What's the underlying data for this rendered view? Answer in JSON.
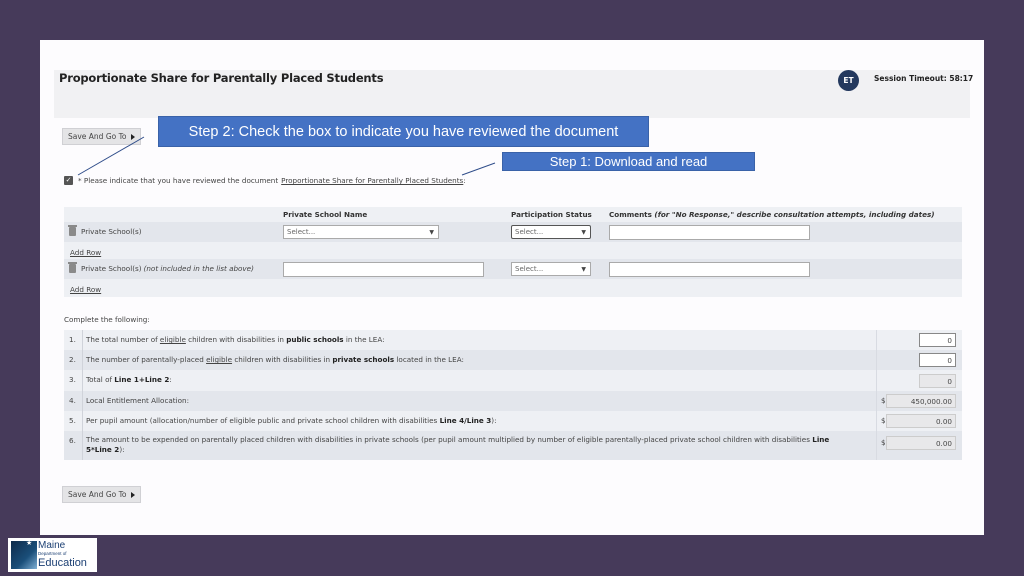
{
  "colors": {
    "slide_background": "#463a5a",
    "callout_blue": "#4472c4",
    "avatar_navy": "#24395e"
  },
  "header": {
    "title": "Proportionate Share for Parentally Placed Students",
    "avatar_initials": "ET",
    "session_timeout": "Session Timeout: 58:17"
  },
  "toolbar": {
    "save_label": "Save And Go To"
  },
  "callouts": {
    "step2": "Step 2: Check the box to indicate you have reviewed the document",
    "step1": "Step 1: Download and read"
  },
  "review": {
    "checked": true,
    "label": "* Please indicate that you have reviewed the document",
    "doc_link": "Proportionate Share for Parentally Placed Students",
    "suffix": ":"
  },
  "schools_table": {
    "headers": {
      "name": "Private School Name",
      "status": "Participation Status",
      "comments_bold": "Comments",
      "comments_italic": "(for \"No Response,\" describe consultation attempts, including dates)"
    },
    "rows": [
      {
        "label": "Private School(s)",
        "label_note": "",
        "name_select": "Select...",
        "status_select": "Select...",
        "comment": ""
      },
      {
        "label": "Private School(s)",
        "label_note": "(not included in the list above)",
        "name_input": "",
        "status_select": "Select...",
        "comment": ""
      }
    ],
    "add_row_label": "Add Row"
  },
  "calc": {
    "intro": "Complete the following:",
    "rows": [
      {
        "num": "1.",
        "parts": [
          "The total number of ",
          "eligible",
          " children with disabilities in ",
          "public schools",
          " in the LEA:"
        ],
        "value": "0",
        "currency": ""
      },
      {
        "num": "2.",
        "parts": [
          "The number of parentally-placed ",
          "eligible",
          " children with disabilities in ",
          "private schools",
          " located in the LEA:"
        ],
        "value": "0",
        "currency": ""
      },
      {
        "num": "3.",
        "parts": [
          "Total of ",
          "Line 1+Line 2",
          ":"
        ],
        "value": "0",
        "currency": ""
      },
      {
        "num": "4.",
        "parts": [
          "Local Entitlement Allocation:"
        ],
        "value": "450,000.00",
        "currency": "$"
      },
      {
        "num": "5.",
        "parts": [
          "Per pupil amount (allocation/number of eligible public and private school children with disabilities ",
          "Line 4/Line 3",
          "):"
        ],
        "value": "0.00",
        "currency": "$"
      },
      {
        "num": "6.",
        "parts": [
          "The amount to be expended on parentally placed children with disabilities in private schools (per pupil amount multiplied by number of eligible parentally-placed private school children with disabilities ",
          "Line",
          "5*Line 2",
          "):"
        ],
        "value": "0.00",
        "currency": "$"
      }
    ]
  },
  "logo": {
    "line1": "Maine",
    "line2": "Department of",
    "line3": "Education"
  }
}
